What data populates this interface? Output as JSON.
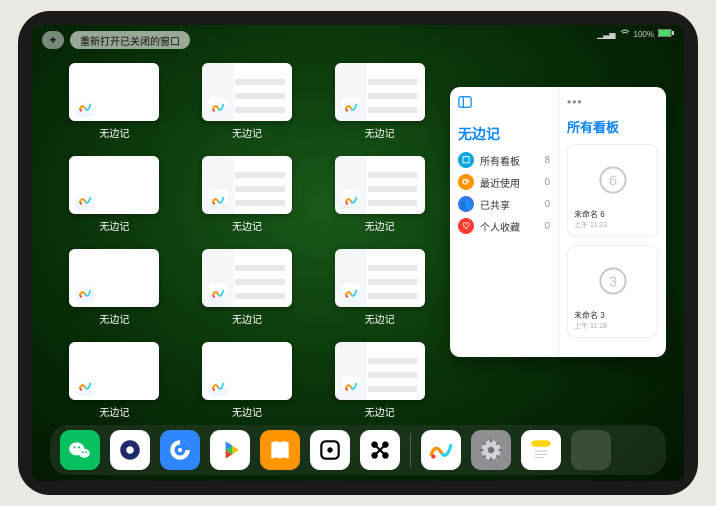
{
  "status": {
    "signal": "▁▃▅",
    "wifi": "⋮",
    "battery_text": "100%"
  },
  "topbar": {
    "reopen_label": "重新打开已关闭的窗口"
  },
  "app_name": "无边记",
  "windows": [
    {
      "label": "无边记",
      "variant": "blank"
    },
    {
      "label": "无边记",
      "variant": "detail"
    },
    {
      "label": "无边记",
      "variant": "detail"
    },
    {
      "label": "无边记",
      "variant": "blank"
    },
    {
      "label": "无边记",
      "variant": "detail"
    },
    {
      "label": "无边记",
      "variant": "detail"
    },
    {
      "label": "无边记",
      "variant": "blank"
    },
    {
      "label": "无边记",
      "variant": "detail"
    },
    {
      "label": "无边记",
      "variant": "detail"
    },
    {
      "label": "无边记",
      "variant": "blank"
    },
    {
      "label": "无边记",
      "variant": "blank"
    },
    {
      "label": "无边记",
      "variant": "detail"
    }
  ],
  "panel": {
    "title": "无边记",
    "right_title": "所有看板",
    "categories": [
      {
        "name": "所有看板",
        "count": 8,
        "color": "#0aa8e0",
        "glyph": "☐"
      },
      {
        "name": "最近使用",
        "count": 0,
        "color": "#ff9500",
        "glyph": "⟳"
      },
      {
        "name": "已共享",
        "count": 0,
        "color": "#3478f6",
        "glyph": "👥"
      },
      {
        "name": "个人收藏",
        "count": 0,
        "color": "#ff3b30",
        "glyph": "♡"
      }
    ],
    "boards": [
      {
        "title": "未命名 6",
        "subtitle": "上午 11:23",
        "digit": "6"
      },
      {
        "title": "未命名 3",
        "subtitle": "上午 11:18",
        "digit": "3"
      }
    ]
  },
  "dock": {
    "main": [
      {
        "name": "wechat",
        "bg": "#07c160"
      },
      {
        "name": "quark",
        "bg": "#ffffff"
      },
      {
        "name": "qq-browser",
        "bg": "#2f86ff"
      },
      {
        "name": "play",
        "bg": "#ffffff"
      },
      {
        "name": "books",
        "bg": "#ff9500"
      },
      {
        "name": "dice",
        "bg": "#ffffff"
      },
      {
        "name": "connect",
        "bg": "#ffffff"
      }
    ],
    "recent": [
      {
        "name": "freeform",
        "bg": "#ffffff"
      },
      {
        "name": "settings",
        "bg": "#8e8e93"
      },
      {
        "name": "notes",
        "bg": "#ffffff"
      },
      {
        "name": "apps-quad",
        "bg": "transparent"
      }
    ]
  }
}
